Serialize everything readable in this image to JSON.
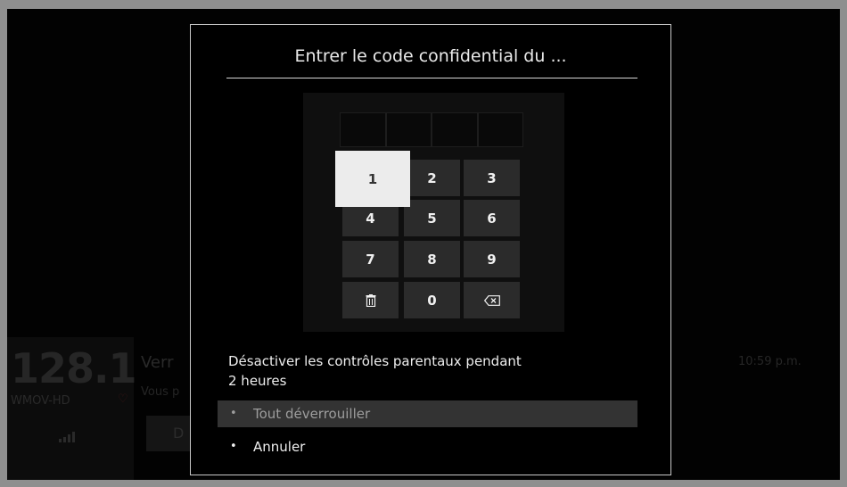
{
  "background": {
    "channel_number": "128.1",
    "station": "WMOV-HD",
    "favorite_icon": "heart-icon",
    "signal_icon": "signal-bars-icon",
    "program_title_partial": "Verr",
    "program_sub_partial": "Vous p",
    "button_partial": "D",
    "time": "10:59 p.m."
  },
  "dialog": {
    "title": "Entrer le code confidential du ...",
    "pin_length": 4,
    "keypad": {
      "keys": [
        "1",
        "2",
        "3",
        "4",
        "5",
        "6",
        "7",
        "8",
        "9",
        "clear",
        "0",
        "backspace"
      ],
      "selected": "1",
      "clear_icon": "trash-icon",
      "backspace_icon": "backspace-icon"
    },
    "message_line1": "Désactiver les contrôles parentaux pendant",
    "message_line2": "2 heures",
    "options": [
      {
        "label": "Tout déverrouiller",
        "highlighted": true
      },
      {
        "label": "Annuler",
        "highlighted": false
      }
    ],
    "bullet": "•"
  }
}
